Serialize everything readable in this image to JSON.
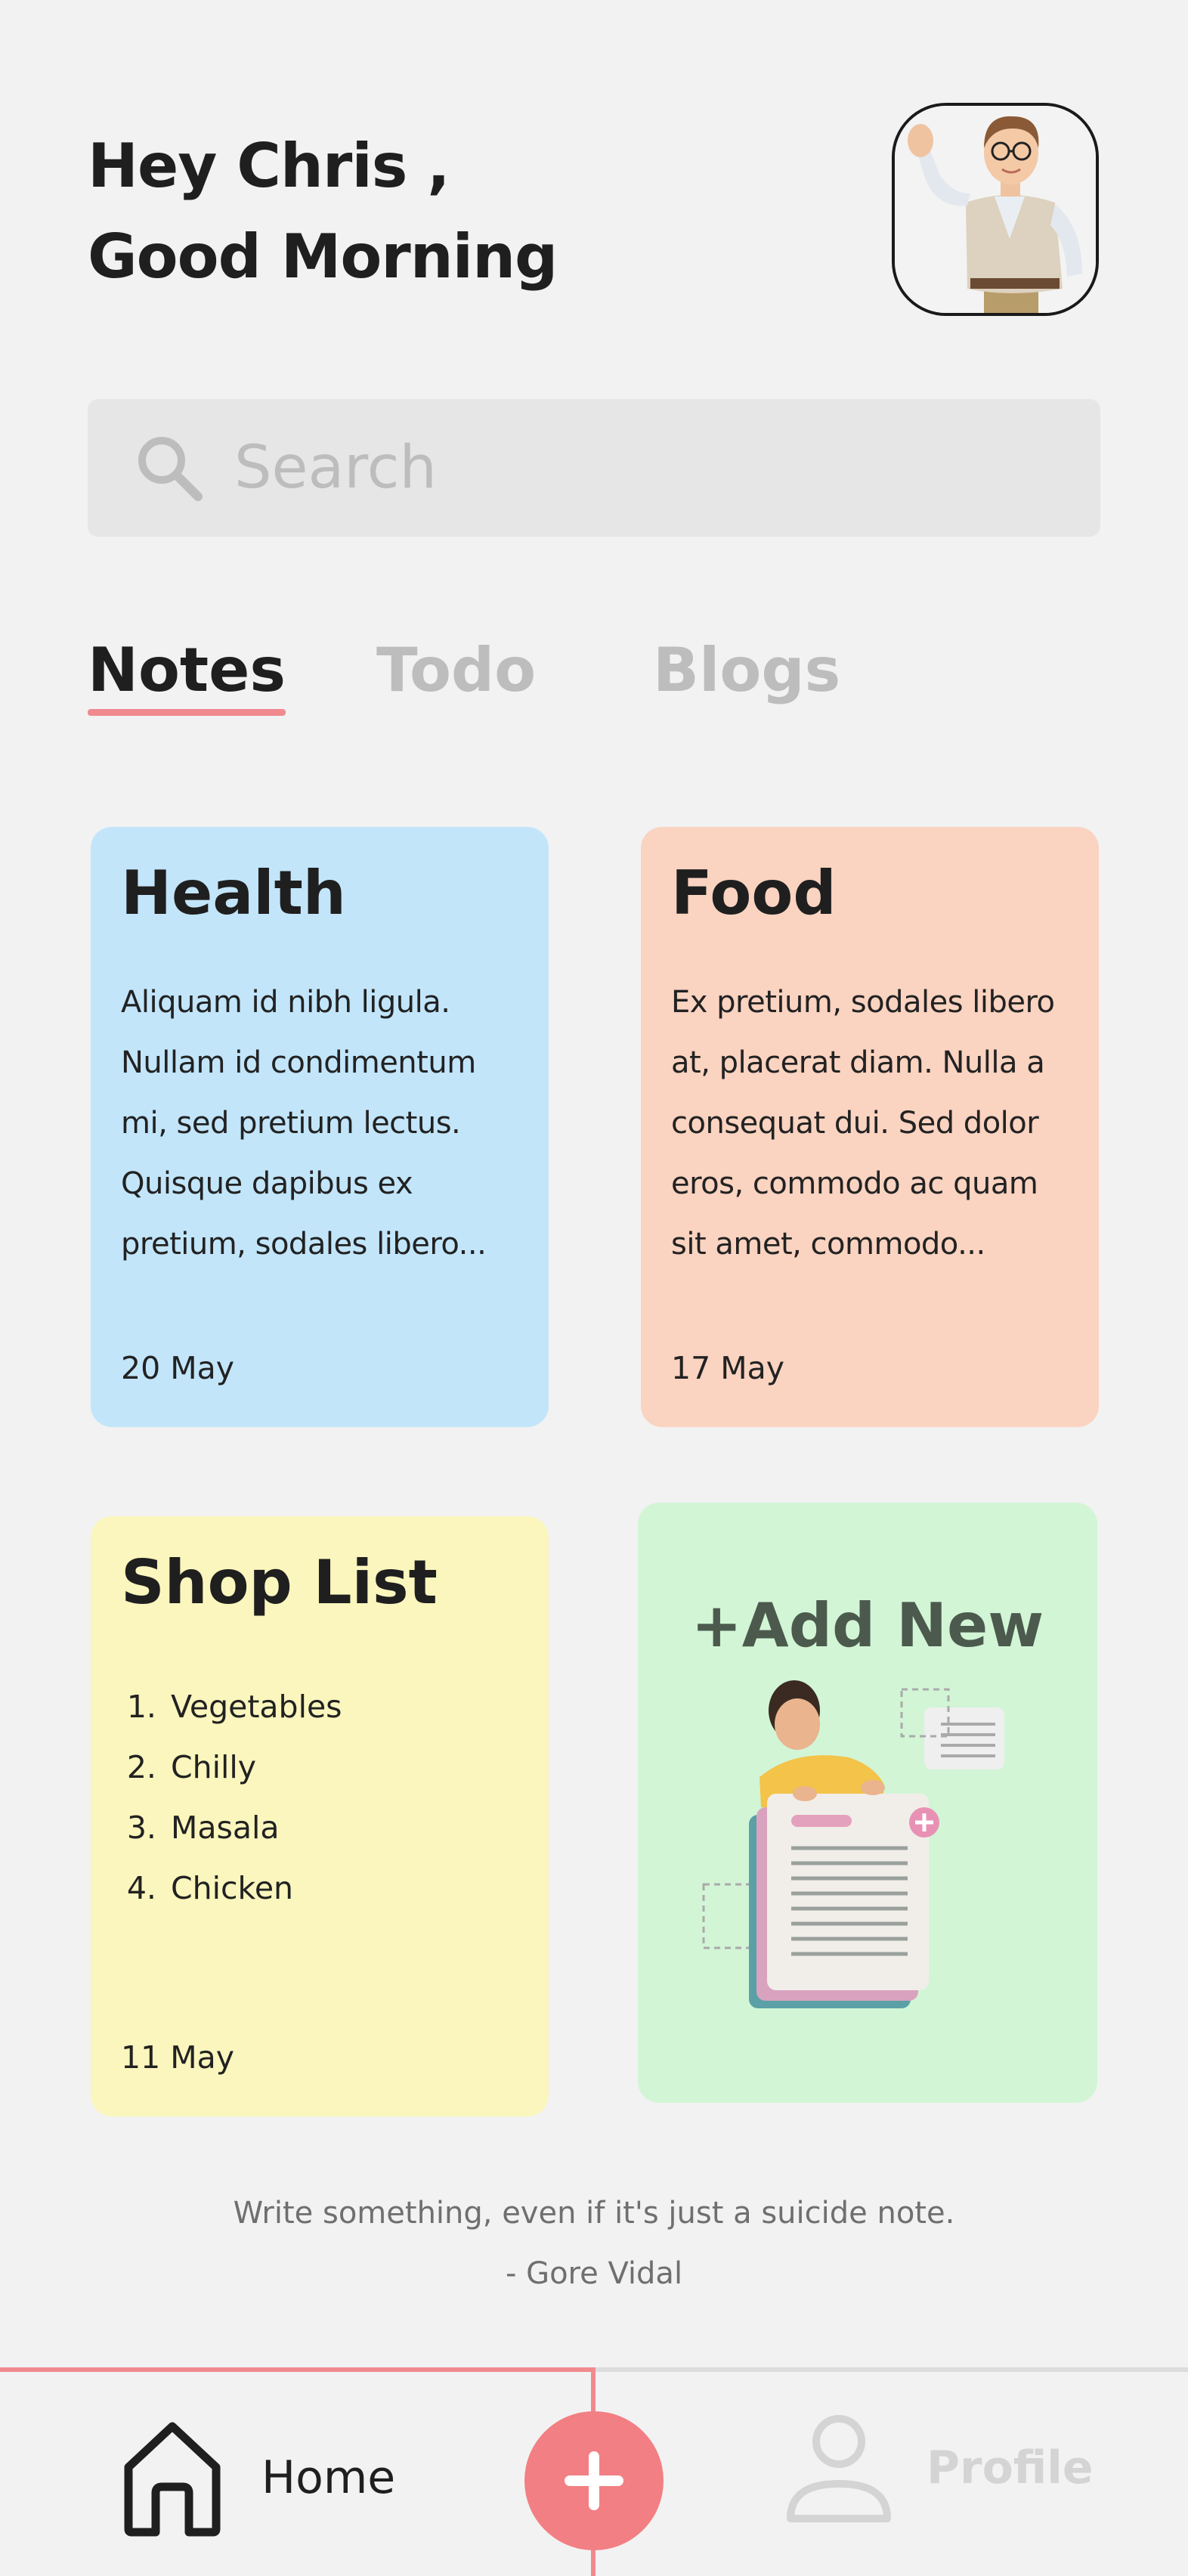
{
  "header": {
    "greeting_line1": "Hey Chris ,",
    "greeting_line2": "Good Morning"
  },
  "search": {
    "placeholder": "Search",
    "icon": "search-icon"
  },
  "tabs": [
    {
      "label": "Notes",
      "active": true
    },
    {
      "label": "Todo",
      "active": false
    },
    {
      "label": "Blogs",
      "active": false
    }
  ],
  "cards": {
    "health": {
      "title": "Health",
      "body_lines": [
        "Aliquam id nibh ligula.",
        "Nullam id condimentum",
        "mi, sed pretium lectus.",
        "Quisque dapibus ex",
        "pretium, sodales libero..."
      ],
      "date": "20 May",
      "color": "#c2e5fa"
    },
    "food": {
      "title": "Food",
      "body_lines": [
        "Ex pretium, sodales libero",
        "at, placerat diam. Nulla a",
        "consequat dui. Sed dolor",
        "eros, commodo ac quam",
        "sit amet, commodo..."
      ],
      "date": "17 May",
      "color": "#fad3c1"
    },
    "shop": {
      "title": "Shop List",
      "items": [
        "Vegetables",
        "Chilly",
        "Masala",
        "Chicken"
      ],
      "date": "11 May",
      "color": "#faf6bd"
    },
    "add_new": {
      "label": "+Add New",
      "color": "#d2f5d6"
    }
  },
  "quote": {
    "text": "Write something, even if it's just a suicide note.",
    "author": "- Gore Vidal"
  },
  "bottom_nav": {
    "home_label": "Home",
    "profile_label": "Profile",
    "accent_color": "#f27f83"
  }
}
